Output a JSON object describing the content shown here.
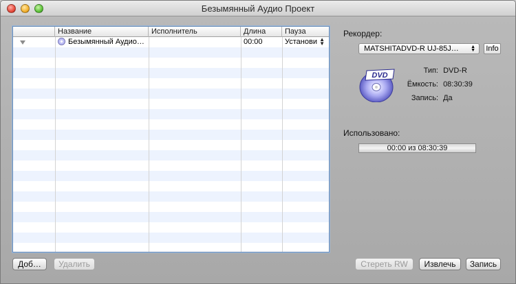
{
  "window": {
    "title": "Безымянный Аудио Проект"
  },
  "table": {
    "columns": [
      "",
      "Название",
      "Исполнитель",
      "Длина",
      "Пауза"
    ],
    "rows": [
      {
        "name": "Безымянный Аудио…",
        "artist": "",
        "length": "00:00",
        "pause": "Установи"
      }
    ]
  },
  "recorder": {
    "label": "Рекордер:",
    "device": "MATSHITADVD-R   UJ-85J…",
    "info_label": "Info",
    "type_key": "Тип:",
    "type_value": "DVD-R",
    "capacity_key": "Ёмкость:",
    "capacity_value": "08:30:39",
    "write_key": "Запись:",
    "write_value": "Да"
  },
  "usage": {
    "label": "Использовано:",
    "value": "00:00 из 08:30:39",
    "fraction": 0
  },
  "buttons": {
    "add": "Доб…",
    "delete": "Удалить",
    "erase": "Стереть RW",
    "eject": "Извлечь",
    "burn": "Запись"
  },
  "icons": {
    "dvd": "dvd-disc-icon",
    "disclosure": "disclosure-triangle-icon",
    "track": "audio-disc-icon"
  }
}
